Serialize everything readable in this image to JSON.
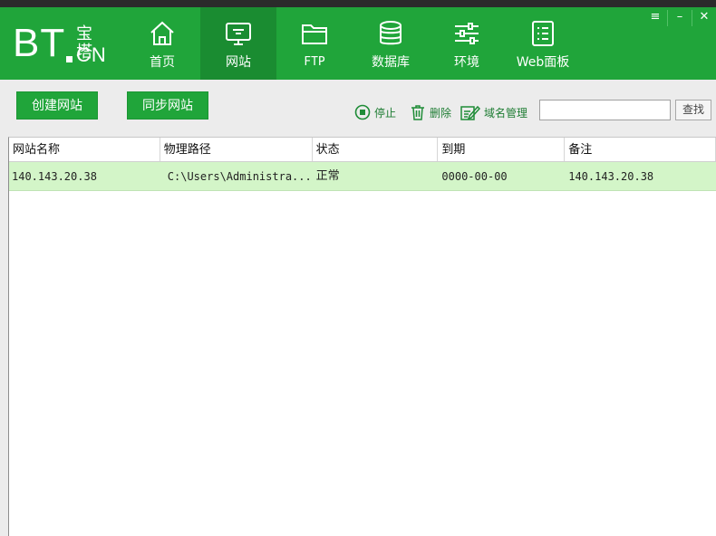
{
  "app": {
    "logo_main": "BT",
    "logo_cn_top": "宝塔",
    "logo_cn_bottom": "CN"
  },
  "nav": [
    {
      "label": "首页",
      "icon": "home-icon",
      "active": false
    },
    {
      "label": "网站",
      "icon": "monitor-icon",
      "active": true
    },
    {
      "label": "FTP",
      "icon": "folder-icon",
      "active": false
    },
    {
      "label": "数据库",
      "icon": "database-icon",
      "active": false
    },
    {
      "label": "环境",
      "icon": "sliders-icon",
      "active": false
    },
    {
      "label": "Web面板",
      "icon": "list-icon",
      "active": false
    }
  ],
  "window_controls": {
    "menu": "≡",
    "minimize": "–",
    "close": "✕"
  },
  "toolbar": {
    "create_site": "创建网站",
    "sync_site": "同步网站",
    "stop": "停止",
    "delete": "删除",
    "domain_manage": "域名管理",
    "search_placeholder": "",
    "search_button": "查找"
  },
  "table": {
    "columns": [
      "网站名称",
      "物理路径",
      "状态",
      "到期",
      "备注"
    ],
    "rows": [
      [
        "140.143.20.38",
        "C:\\Users\\Administra...",
        "正常",
        "0000-00-00",
        "140.143.20.38"
      ]
    ]
  },
  "colors": {
    "brand": "#20a53a",
    "brand_dark": "#1a8c31",
    "row_selected": "#d3f5c8"
  }
}
